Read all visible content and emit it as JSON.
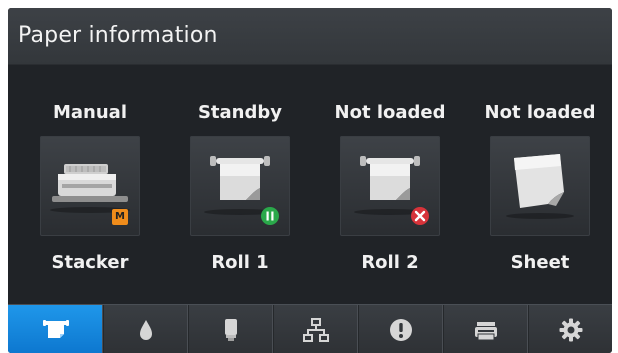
{
  "header": {
    "title": "Paper information"
  },
  "trays": [
    {
      "status": "Manual",
      "name": "Stacker",
      "badge": "manual",
      "icon": "stacker-icon",
      "badge_letter": "M"
    },
    {
      "status": "Standby",
      "name": "Roll 1",
      "badge": "pause",
      "icon": "roll-paper-icon"
    },
    {
      "status": "Not loaded",
      "name": "Roll 2",
      "badge": "error",
      "icon": "roll-paper-icon"
    },
    {
      "status": "Not loaded",
      "name": "Sheet",
      "badge": "none",
      "icon": "sheet-paper-icon"
    }
  ],
  "nav": {
    "items": [
      {
        "icon": "paper-icon",
        "active": true
      },
      {
        "icon": "ink-drop-icon",
        "active": false
      },
      {
        "icon": "printhead-icon",
        "active": false
      },
      {
        "icon": "network-icon",
        "active": false
      },
      {
        "icon": "alert-icon",
        "active": false
      },
      {
        "icon": "printer-icon",
        "active": false
      },
      {
        "icon": "settings-gear-icon",
        "active": false
      }
    ]
  },
  "colors": {
    "accent": "#1f8fe6",
    "manual_badge": "#f08c1b",
    "standby_badge": "#2aa84a",
    "error_badge": "#d7333a"
  }
}
